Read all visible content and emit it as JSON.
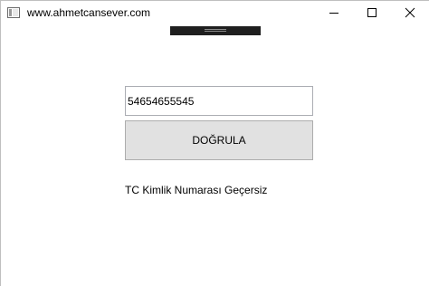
{
  "window": {
    "title": "www.ahmetcansever.com",
    "icons": {
      "app": "app-icon",
      "minimize": "minimize-icon",
      "maximize": "maximize-icon",
      "close": "close-icon"
    }
  },
  "form": {
    "id_value": "54654655545",
    "verify_label": "DOĞRULA",
    "status_text": "TC Kimlik Numarası Geçersiz"
  },
  "colors": {
    "button_bg": "#e1e1e1",
    "button_border": "#adadad",
    "input_border": "#abadb3",
    "debug_bar": "#1f1f1f"
  }
}
